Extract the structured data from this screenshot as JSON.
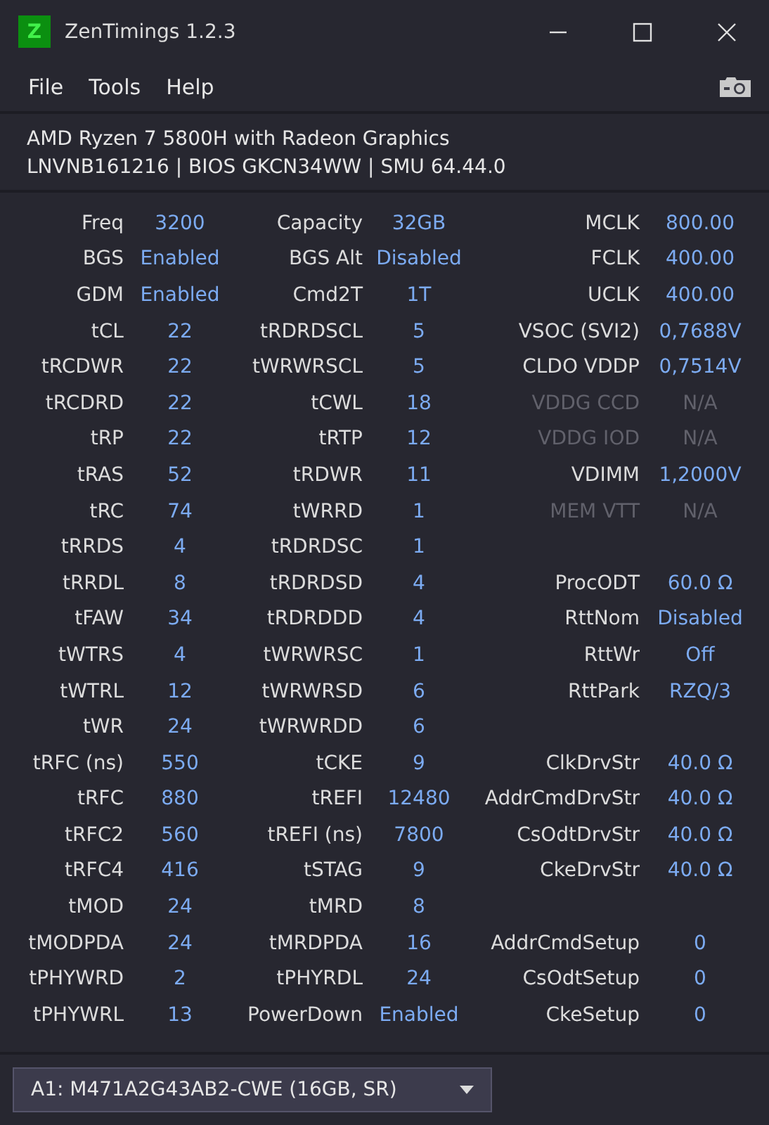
{
  "window": {
    "logo_letter": "Z",
    "title": "ZenTimings 1.2.3"
  },
  "menu": [
    "File",
    "Tools",
    "Help"
  ],
  "system": {
    "cpu": "AMD Ryzen 7 5800H with Radeon Graphics",
    "details": "LNVNB161216 | BIOS GKCN34WW | SMU 64.44.0"
  },
  "rows": [
    {
      "left": {
        "label": "Freq",
        "value": "3200",
        "disabled": false
      },
      "middle": {
        "label": "Capacity",
        "value": "32GB",
        "disabled": false
      },
      "right": {
        "label": "MCLK",
        "value": "800.00",
        "disabled": false
      }
    },
    {
      "left": {
        "label": "BGS",
        "value": "Enabled",
        "disabled": false
      },
      "middle": {
        "label": "BGS Alt",
        "value": "Disabled",
        "disabled": false
      },
      "right": {
        "label": "FCLK",
        "value": "400.00",
        "disabled": false
      }
    },
    {
      "left": {
        "label": "GDM",
        "value": "Enabled",
        "disabled": false
      },
      "middle": {
        "label": "Cmd2T",
        "value": "1T",
        "disabled": false
      },
      "right": {
        "label": "UCLK",
        "value": "400.00",
        "disabled": false
      }
    },
    {
      "left": {
        "label": "tCL",
        "value": "22",
        "disabled": false
      },
      "middle": {
        "label": "tRDRDSCL",
        "value": "5",
        "disabled": false
      },
      "right": {
        "label": "VSOC (SVI2)",
        "value": "0,7688V",
        "disabled": false
      }
    },
    {
      "left": {
        "label": "tRCDWR",
        "value": "22",
        "disabled": false
      },
      "middle": {
        "label": "tWRWRSCL",
        "value": "5",
        "disabled": false
      },
      "right": {
        "label": "CLDO VDDP",
        "value": "0,7514V",
        "disabled": false
      }
    },
    {
      "left": {
        "label": "tRCDRD",
        "value": "22",
        "disabled": false
      },
      "middle": {
        "label": "tCWL",
        "value": "18",
        "disabled": false
      },
      "right": {
        "label": "VDDG CCD",
        "value": "N/A",
        "disabled": true
      }
    },
    {
      "left": {
        "label": "tRP",
        "value": "22",
        "disabled": false
      },
      "middle": {
        "label": "tRTP",
        "value": "12",
        "disabled": false
      },
      "right": {
        "label": "VDDG IOD",
        "value": "N/A",
        "disabled": true
      }
    },
    {
      "left": {
        "label": "tRAS",
        "value": "52",
        "disabled": false
      },
      "middle": {
        "label": "tRDWR",
        "value": "11",
        "disabled": false
      },
      "right": {
        "label": "VDIMM",
        "value": "1,2000V",
        "disabled": false
      }
    },
    {
      "left": {
        "label": "tRC",
        "value": "74",
        "disabled": false
      },
      "middle": {
        "label": "tWRRD",
        "value": "1",
        "disabled": false
      },
      "right": {
        "label": "MEM VTT",
        "value": "N/A",
        "disabled": true
      }
    },
    {
      "left": {
        "label": "tRRDS",
        "value": "4",
        "disabled": false
      },
      "middle": {
        "label": "tRDRDSC",
        "value": "1",
        "disabled": false
      }
    },
    {
      "left": {
        "label": "tRRDL",
        "value": "8",
        "disabled": false
      },
      "middle": {
        "label": "tRDRDSD",
        "value": "4",
        "disabled": false
      },
      "right": {
        "label": "ProcODT",
        "value": "60.0 Ω",
        "disabled": false
      }
    },
    {
      "left": {
        "label": "tFAW",
        "value": "34",
        "disabled": false
      },
      "middle": {
        "label": "tRDRDDD",
        "value": "4",
        "disabled": false
      },
      "right": {
        "label": "RttNom",
        "value": "Disabled",
        "disabled": false
      }
    },
    {
      "left": {
        "label": "tWTRS",
        "value": "4",
        "disabled": false
      },
      "middle": {
        "label": "tWRWRSC",
        "value": "1",
        "disabled": false
      },
      "right": {
        "label": "RttWr",
        "value": "Off",
        "disabled": false
      }
    },
    {
      "left": {
        "label": "tWTRL",
        "value": "12",
        "disabled": false
      },
      "middle": {
        "label": "tWRWRSD",
        "value": "6",
        "disabled": false
      },
      "right": {
        "label": "RttPark",
        "value": "RZQ/3",
        "disabled": false
      }
    },
    {
      "left": {
        "label": "tWR",
        "value": "24",
        "disabled": false
      },
      "middle": {
        "label": "tWRWRDD",
        "value": "6",
        "disabled": false
      }
    },
    {
      "left": {
        "label": "tRFC (ns)",
        "value": "550",
        "disabled": false
      },
      "middle": {
        "label": "tCKE",
        "value": "9",
        "disabled": false
      },
      "right": {
        "label": "ClkDrvStr",
        "value": "40.0 Ω",
        "disabled": false
      }
    },
    {
      "left": {
        "label": "tRFC",
        "value": "880",
        "disabled": false
      },
      "middle": {
        "label": "tREFI",
        "value": "12480",
        "disabled": false
      },
      "right": {
        "label": "AddrCmdDrvStr",
        "value": "40.0 Ω",
        "disabled": false
      }
    },
    {
      "left": {
        "label": "tRFC2",
        "value": "560",
        "disabled": false
      },
      "middle": {
        "label": "tREFI (ns)",
        "value": "7800",
        "disabled": false
      },
      "right": {
        "label": "CsOdtDrvStr",
        "value": "40.0 Ω",
        "disabled": false
      }
    },
    {
      "left": {
        "label": "tRFC4",
        "value": "416",
        "disabled": false
      },
      "middle": {
        "label": "tSTAG",
        "value": "9",
        "disabled": false
      },
      "right": {
        "label": "CkeDrvStr",
        "value": "40.0 Ω",
        "disabled": false
      }
    },
    {
      "left": {
        "label": "tMOD",
        "value": "24",
        "disabled": false
      },
      "middle": {
        "label": "tMRD",
        "value": "8",
        "disabled": false
      }
    },
    {
      "left": {
        "label": "tMODPDA",
        "value": "24",
        "disabled": false
      },
      "middle": {
        "label": "tMRDPDA",
        "value": "16",
        "disabled": false
      },
      "right": {
        "label": "AddrCmdSetup",
        "value": "0",
        "disabled": false
      }
    },
    {
      "left": {
        "label": "tPHYWRD",
        "value": "2",
        "disabled": false
      },
      "middle": {
        "label": "tPHYRDL",
        "value": "24",
        "disabled": false
      },
      "right": {
        "label": "CsOdtSetup",
        "value": "0",
        "disabled": false
      }
    },
    {
      "left": {
        "label": "tPHYWRL",
        "value": "13",
        "disabled": false
      },
      "middle": {
        "label": "PowerDown",
        "value": "Enabled",
        "disabled": false
      },
      "right": {
        "label": "CkeSetup",
        "value": "0",
        "disabled": false
      }
    }
  ],
  "module_select": {
    "value": "A1: M471A2G43AB2-CWE (16GB, SR)"
  }
}
